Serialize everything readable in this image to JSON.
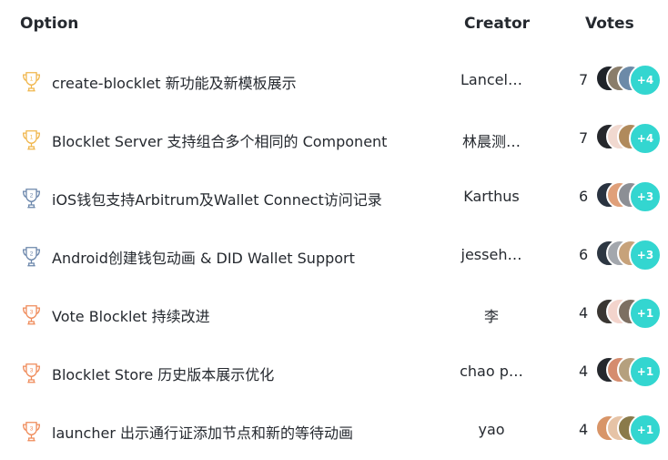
{
  "header": {
    "option": "Option",
    "creator": "Creator",
    "votes": "Votes"
  },
  "rows": [
    {
      "rank": "1",
      "rank_color": "#f0b64c",
      "label": "create-blocklet 新功能及新模板展示",
      "creator": "Lancel…",
      "count": "7",
      "more": "+4",
      "avatar_colors": [
        "#1f2329",
        "#8a7d6a",
        "#6c8aa8"
      ]
    },
    {
      "rank": "1",
      "rank_color": "#f0b64c",
      "label": "Blocklet Server 支持组合多个相同的 Component",
      "creator": "林晨测…",
      "count": "7",
      "more": "+4",
      "avatar_colors": [
        "#26282c",
        "#f1d9d0",
        "#b08a5c"
      ]
    },
    {
      "rank": "2",
      "rank_color": "#6b86ab",
      "label": "iOS钱包支持Arbitrum及Wallet Connect访问记录",
      "creator": "Karthus",
      "count": "6",
      "more": "+3",
      "avatar_colors": [
        "#2a3340",
        "#e0a07a",
        "#8c8f95"
      ]
    },
    {
      "rank": "2",
      "rank_color": "#6b86ab",
      "label": "Android创建钱包动画 & DID Wallet Support",
      "creator": "jesseh…",
      "count": "6",
      "more": "+3",
      "avatar_colors": [
        "#2d3742",
        "#a3a7ad",
        "#c7a27a"
      ]
    },
    {
      "rank": "3",
      "rank_color": "#ef8b5a",
      "label": "Vote Blocklet 持续改进",
      "creator": "李",
      "count": "4",
      "more": "+1",
      "avatar_colors": [
        "#3a3632",
        "#f3d4cc",
        "#7d6f62"
      ]
    },
    {
      "rank": "3",
      "rank_color": "#ef8b5a",
      "label": "Blocklet Store 历史版本展示优化",
      "creator": "chao p…",
      "count": "4",
      "more": "+1",
      "avatar_colors": [
        "#25282d",
        "#d58c6e",
        "#b5a07e"
      ]
    },
    {
      "rank": "3",
      "rank_color": "#ef8b5a",
      "label": "launcher 出示通行证添加节点和新的等待动画",
      "creator": "yao",
      "count": "4",
      "more": "+1",
      "avatar_colors": [
        "#d89568",
        "#e6c3a6",
        "#8a7a4a"
      ]
    }
  ]
}
